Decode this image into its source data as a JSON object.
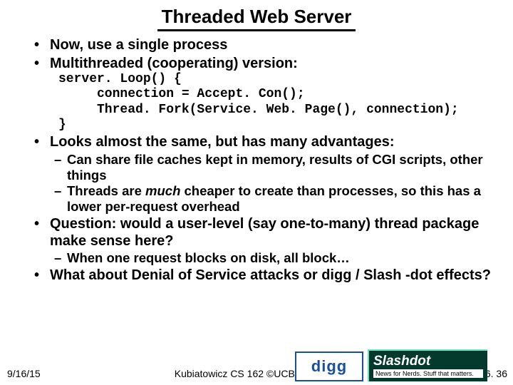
{
  "title": "Threaded Web Server",
  "bullets": {
    "b1": "Now, use a single process",
    "b2": "Multithreaded (cooperating) version:",
    "b3": "Looks almost the same, but has many advantages:",
    "b4": "Question: would a user-level (say one-to-many) thread package make sense here?",
    "b5": "What about Denial of Service attacks or digg / Slash -dot effects?"
  },
  "code": "server. Loop() {\n     connection = Accept. Con();\n     Thread. Fork(Service. Web. Page(), connection);\n}",
  "subs": {
    "s1": "Can share file caches kept in memory, results of CGI scripts, other things",
    "s2a": "Threads are ",
    "s2b": "much",
    "s2c": " cheaper to create than processes, so this has a lower per-request overhead",
    "s3": "When one request blocks on disk, all block…"
  },
  "footer": {
    "date": "9/16/15",
    "middle": "Kubiatowicz CS 162 ©UCB Fall 2015",
    "right": "Lec 6. 36"
  },
  "logos": {
    "digg": "digg",
    "slashdot_title": "Slashdot",
    "slashdot_sub": "News for Nerds.  Stuff that matters."
  }
}
